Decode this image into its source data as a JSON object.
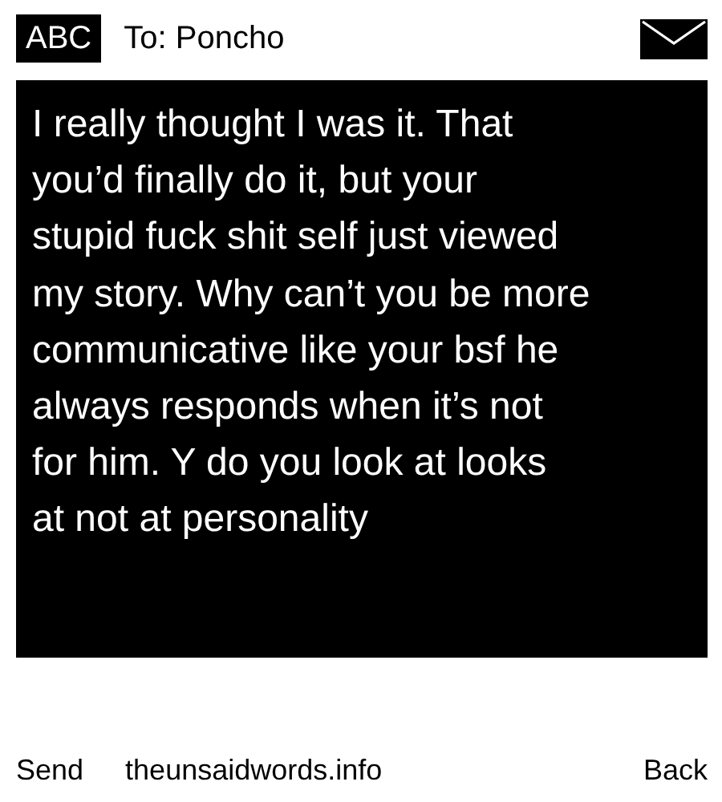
{
  "header": {
    "mode": "ABC",
    "recipient": "To: Poncho"
  },
  "message_lines": [
    "I really thought I was it. That",
    "you’d finally do it, but your",
    "stupid fuck shit self just viewed",
    "my story. Why can’t you be more",
    "communicative like your bsf he",
    "always responds when it’s not",
    "for him. Y do you look at looks",
    "at not at personality"
  ],
  "footer": {
    "left": "Send",
    "center": "theunsaidwords.info",
    "right": "Back"
  }
}
